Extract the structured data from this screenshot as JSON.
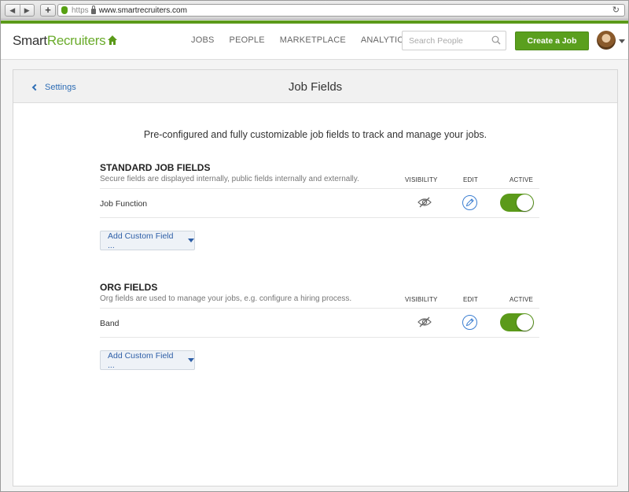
{
  "browser": {
    "back": "◀",
    "forward": "▶",
    "new_tab": "+",
    "url_scheme": "https",
    "url": "www.smartrecruiters.com",
    "reload": "↻"
  },
  "header": {
    "logo_smart": "Smart",
    "logo_recruiters": "Recruiters",
    "nav": [
      "JOBS",
      "PEOPLE",
      "MARKETPLACE",
      "ANALYTICS"
    ],
    "search_placeholder": "Search People",
    "create_job": "Create a Job",
    "brand_green": "#5b9a1a"
  },
  "page": {
    "back_label": "Settings",
    "title": "Job Fields",
    "intro": "Pre-configured and fully customizable job fields to track and manage your jobs."
  },
  "columns": {
    "visibility": "VISIBILITY",
    "edit": "EDIT",
    "active": "ACTIVE"
  },
  "sections": [
    {
      "title": "STANDARD JOB FIELDS",
      "description": "Secure fields are displayed internally, public fields internally and externally.",
      "fields": [
        {
          "name": "Job Function",
          "visibility_icon": "eye-hidden-icon",
          "active": true
        }
      ],
      "add_label": "Add Custom Field ..."
    },
    {
      "title": "ORG FIELDS",
      "description": "Org fields are used to manage your jobs, e.g. configure a hiring process.",
      "fields": [
        {
          "name": "Band",
          "visibility_icon": "eye-hidden-icon",
          "active": true
        }
      ],
      "add_label": "Add Custom Field ..."
    }
  ]
}
